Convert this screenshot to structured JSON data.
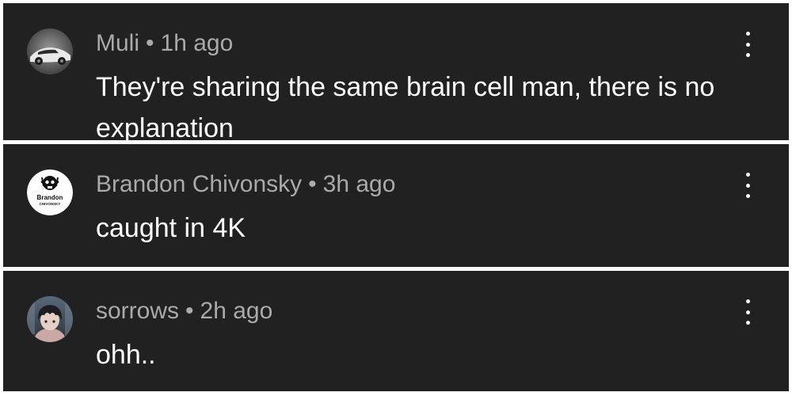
{
  "comments": [
    {
      "author": "Muli",
      "separator": "•",
      "time": "1h ago",
      "text": "They're sharing the same brain cell man, there is no explanation",
      "avatar_icon": "car-avatar"
    },
    {
      "author": "Brandon Chivonsky",
      "separator": "•",
      "time": "3h ago",
      "text": "caught in 4K",
      "avatar_icon": "skull-logo-avatar",
      "avatar_text": [
        "Brandon",
        "CHIVONSKY"
      ]
    },
    {
      "author": "sorrows",
      "separator": "•",
      "time": "2h ago",
      "text": "ohh..",
      "avatar_icon": "anime-character-avatar"
    }
  ],
  "colors": {
    "background": "#212121",
    "meta_text": "#aaaaaa",
    "body_text": "#ffffff",
    "separator": "#ffffff"
  },
  "menu_icon": "more-vert-icon"
}
